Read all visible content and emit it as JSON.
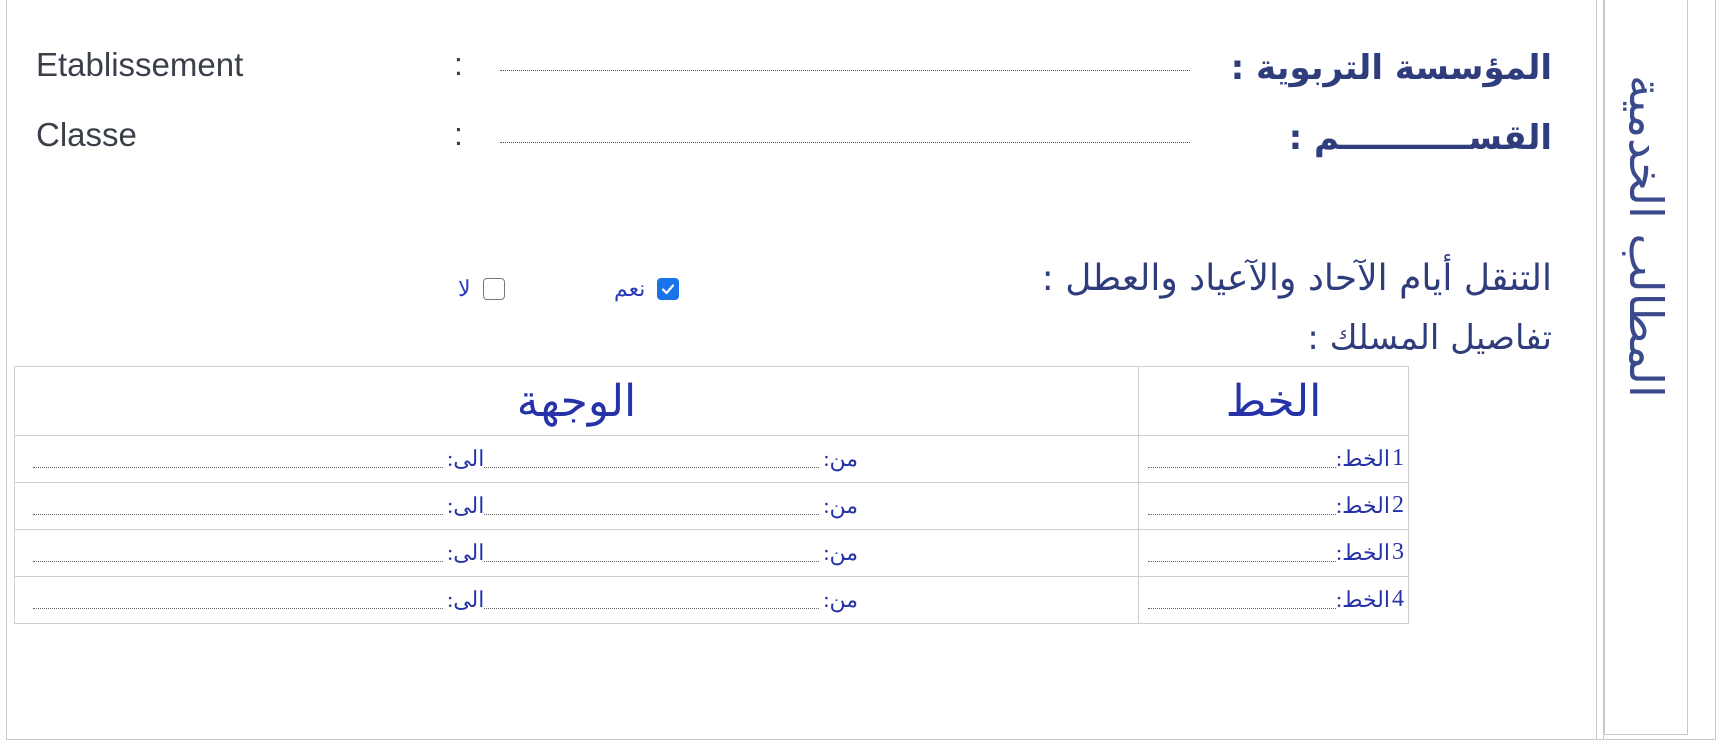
{
  "side_title": "المطالب الخدمية",
  "fields": [
    {
      "fr": "Etablissement",
      "colon": ":",
      "ar": "المؤسسة التربوية :"
    },
    {
      "fr": "Classe",
      "colon": ":",
      "ar": "القســـــــــــم :"
    }
  ],
  "question": {
    "text": "التنقل أيام الآحاد والآعياد والعطل :",
    "yes_label": "نعم",
    "no_label": "لا",
    "yes_checked": true,
    "no_checked": false
  },
  "route_title": "تفاصيل المسلك :",
  "table": {
    "headers": [
      "الخط",
      "الوجهة"
    ],
    "line_label": "الخط:",
    "from_label": "من:",
    "to_label": "الى:",
    "rows": [
      {
        "num": "1"
      },
      {
        "num": "2"
      },
      {
        "num": "3"
      },
      {
        "num": "4"
      }
    ]
  }
}
